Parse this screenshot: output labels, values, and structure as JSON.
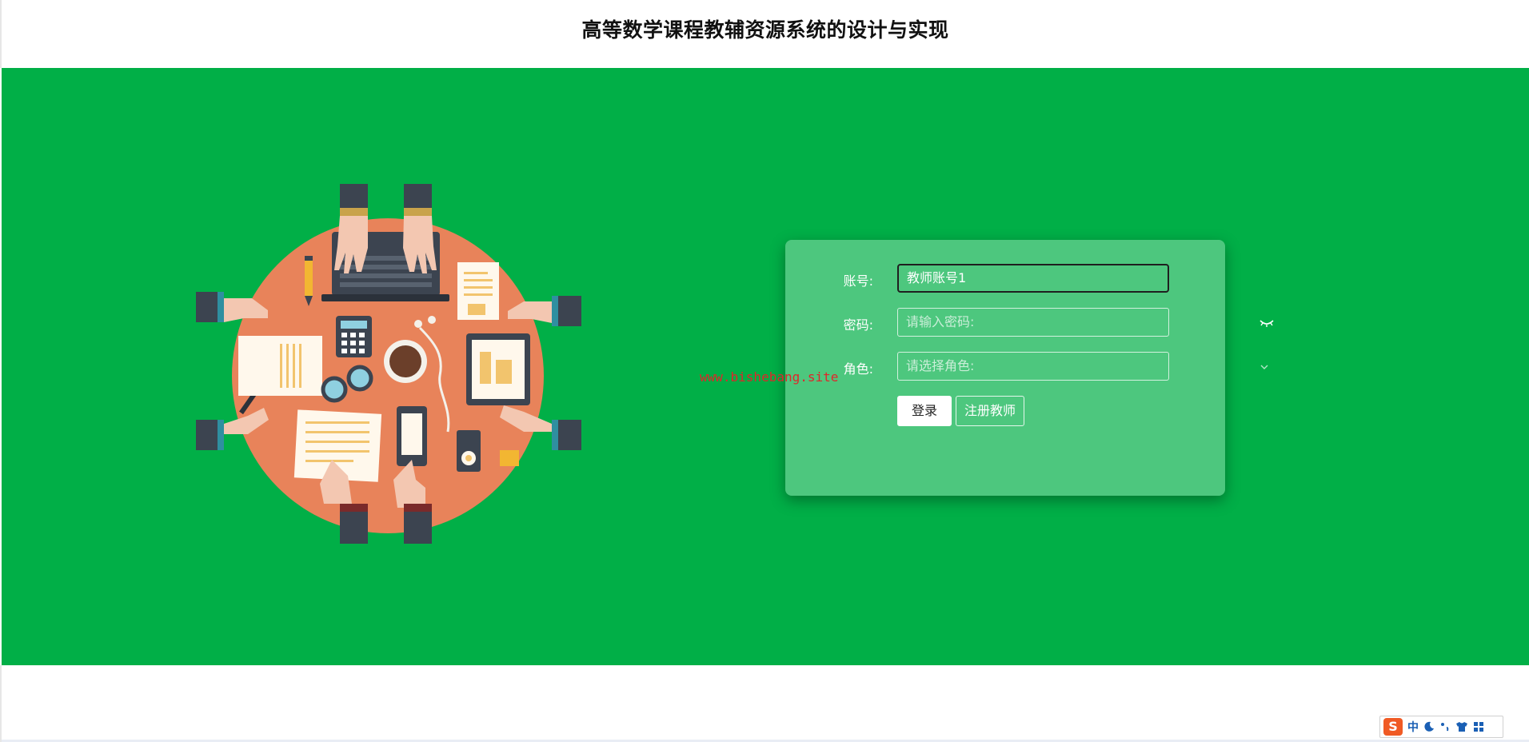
{
  "header": {
    "title": "高等数学课程教辅资源系统的设计与实现"
  },
  "login_form": {
    "account": {
      "label": "账号:",
      "value": "教师账号1"
    },
    "password": {
      "label": "密码:",
      "placeholder": "请输入密码:"
    },
    "role": {
      "label": "角色:",
      "placeholder": "请选择角色:"
    },
    "login_button": "登录",
    "register_button": "注册教师"
  },
  "watermark": "www.bishebang.site",
  "ime_toolbar": {
    "logo": "S",
    "mode": "中"
  },
  "colors": {
    "hero_background": "#01af47",
    "table": "#e8835a",
    "watermark": "#e0262a"
  }
}
